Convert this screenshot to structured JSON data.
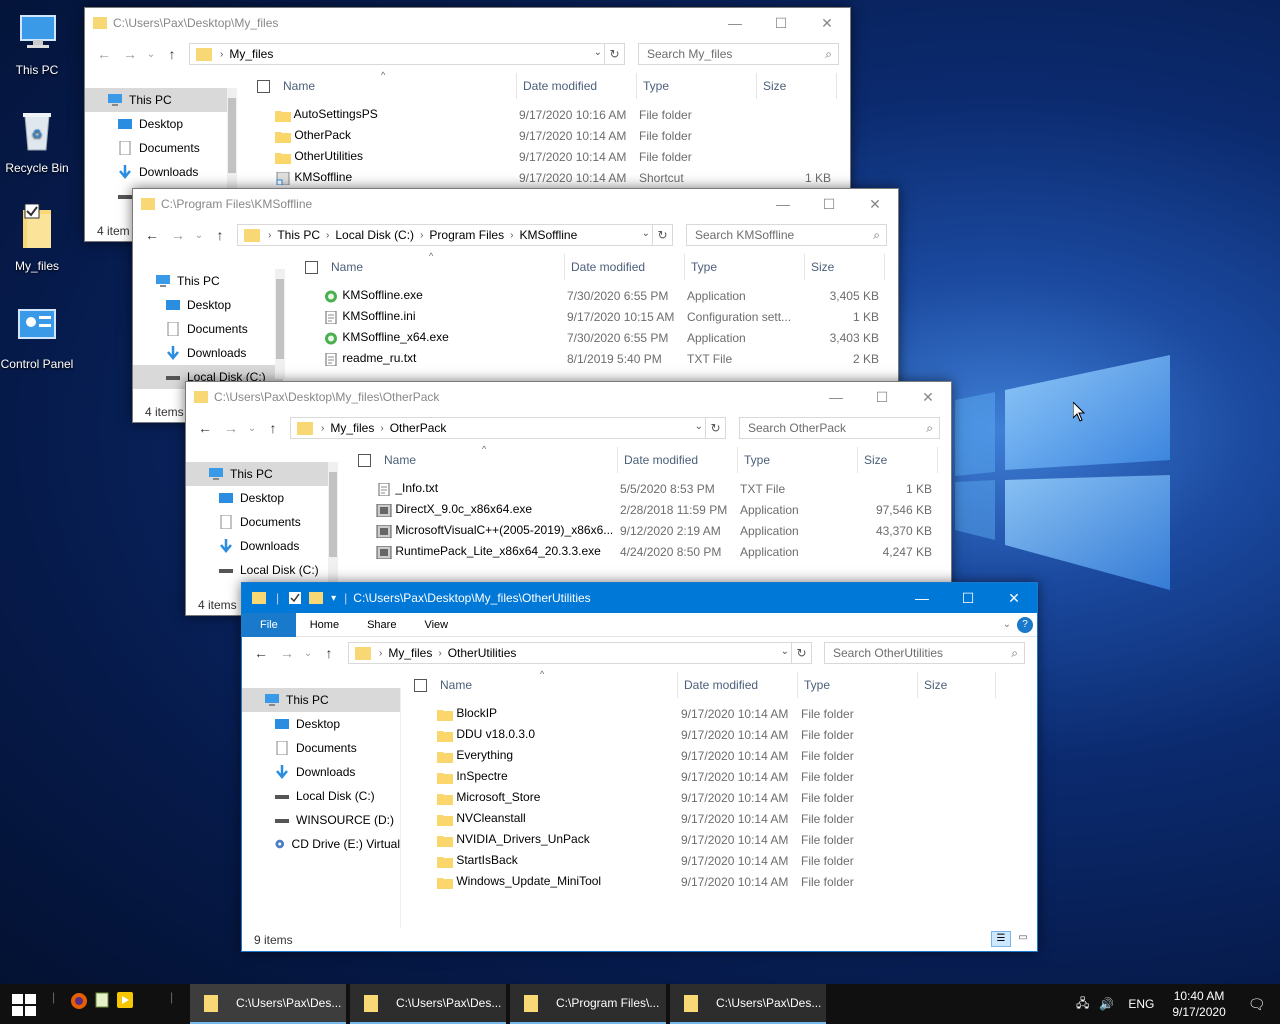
{
  "desktop": {
    "icons": [
      {
        "label": "This PC"
      },
      {
        "label": "Recycle Bin"
      },
      {
        "label": "My_files"
      },
      {
        "label": "Control Panel"
      }
    ]
  },
  "win1": {
    "title": "C:\\Users\\Pax\\Desktop\\My_files",
    "crumbs": [
      "My_files"
    ],
    "search_placeholder": "Search My_files",
    "nav": [
      "This PC",
      "Desktop",
      "Documents",
      "Downloads"
    ],
    "columns": [
      "Name",
      "Date modified",
      "Type",
      "Size"
    ],
    "rows": [
      {
        "name": "AutoSettingsPS",
        "date": "9/17/2020 10:16 AM",
        "type": "File folder",
        "size": ""
      },
      {
        "name": "OtherPack",
        "date": "9/17/2020 10:14 AM",
        "type": "File folder",
        "size": ""
      },
      {
        "name": "OtherUtilities",
        "date": "9/17/2020 10:14 AM",
        "type": "File folder",
        "size": ""
      },
      {
        "name": "KMSoffline",
        "date": "9/17/2020 10:14 AM",
        "type": "Shortcut",
        "size": "1 KB"
      }
    ],
    "status": "4 item"
  },
  "win2": {
    "title": "C:\\Program Files\\KMSoffline",
    "crumbs": [
      "This PC",
      "Local Disk (C:)",
      "Program Files",
      "KMSoffline"
    ],
    "search_placeholder": "Search KMSoffline",
    "nav": [
      "This PC",
      "Desktop",
      "Documents",
      "Downloads",
      "Local Disk (C:)"
    ],
    "columns": [
      "Name",
      "Date modified",
      "Type",
      "Size"
    ],
    "rows": [
      {
        "name": "KMSoffline.exe",
        "date": "7/30/2020 6:55 PM",
        "type": "Application",
        "size": "3,405 KB"
      },
      {
        "name": "KMSoffline.ini",
        "date": "9/17/2020 10:15 AM",
        "type": "Configuration sett...",
        "size": "1 KB"
      },
      {
        "name": "KMSoffline_x64.exe",
        "date": "7/30/2020 6:55 PM",
        "type": "Application",
        "size": "3,403 KB"
      },
      {
        "name": "readme_ru.txt",
        "date": "8/1/2019 5:40 PM",
        "type": "TXT File",
        "size": "2 KB"
      }
    ],
    "status": "4 items"
  },
  "win3": {
    "title": "C:\\Users\\Pax\\Desktop\\My_files\\OtherPack",
    "crumbs": [
      "My_files",
      "OtherPack"
    ],
    "search_placeholder": "Search OtherPack",
    "nav": [
      "This PC",
      "Desktop",
      "Documents",
      "Downloads",
      "Local Disk (C:)"
    ],
    "columns": [
      "Name",
      "Date modified",
      "Type",
      "Size"
    ],
    "rows": [
      {
        "name": "_Info.txt",
        "date": "5/5/2020 8:53 PM",
        "type": "TXT File",
        "size": "1 KB"
      },
      {
        "name": "DirectX_9.0c_x86x64.exe",
        "date": "2/28/2018 11:59 PM",
        "type": "Application",
        "size": "97,546 KB"
      },
      {
        "name": "MicrosoftVisualC++(2005-2019)_x86x6...",
        "date": "9/12/2020 2:19 AM",
        "type": "Application",
        "size": "43,370 KB"
      },
      {
        "name": "RuntimePack_Lite_x86x64_20.3.3.exe",
        "date": "4/24/2020 8:50 PM",
        "type": "Application",
        "size": "4,247 KB"
      }
    ],
    "status": "4 items"
  },
  "win4": {
    "title": "C:\\Users\\Pax\\Desktop\\My_files\\OtherUtilities",
    "tabs": [
      "File",
      "Home",
      "Share",
      "View"
    ],
    "crumbs": [
      "My_files",
      "OtherUtilities"
    ],
    "search_placeholder": "Search OtherUtilities",
    "nav": [
      "This PC",
      "Desktop",
      "Documents",
      "Downloads",
      "Local Disk (C:)",
      "WINSOURCE (D:)",
      "CD Drive (E:) Virtual"
    ],
    "columns": [
      "Name",
      "Date modified",
      "Type",
      "Size"
    ],
    "rows": [
      {
        "name": "BlockIP",
        "date": "9/17/2020 10:14 AM",
        "type": "File folder"
      },
      {
        "name": "DDU v18.0.3.0",
        "date": "9/17/2020 10:14 AM",
        "type": "File folder"
      },
      {
        "name": "Everything",
        "date": "9/17/2020 10:14 AM",
        "type": "File folder"
      },
      {
        "name": "InSpectre",
        "date": "9/17/2020 10:14 AM",
        "type": "File folder"
      },
      {
        "name": "Microsoft_Store",
        "date": "9/17/2020 10:14 AM",
        "type": "File folder"
      },
      {
        "name": "NVCleanstall",
        "date": "9/17/2020 10:14 AM",
        "type": "File folder"
      },
      {
        "name": "NVIDIA_Drivers_UnPack",
        "date": "9/17/2020 10:14 AM",
        "type": "File folder"
      },
      {
        "name": "StartIsBack",
        "date": "9/17/2020 10:14 AM",
        "type": "File folder"
      },
      {
        "name": "Windows_Update_MiniTool",
        "date": "9/17/2020 10:14 AM",
        "type": "File folder"
      }
    ],
    "status": "9 items"
  },
  "taskbar": {
    "buttons": [
      "C:\\Users\\Pax\\Des...",
      "C:\\Users\\Pax\\Des...",
      "C:\\Program Files\\...",
      "C:\\Users\\Pax\\Des..."
    ],
    "lang": "ENG",
    "time": "10:40 AM",
    "date": "9/17/2020"
  },
  "colors": {
    "accent": "#0078d7",
    "folder": "#f8d775",
    "selected": "#cce8ff"
  }
}
